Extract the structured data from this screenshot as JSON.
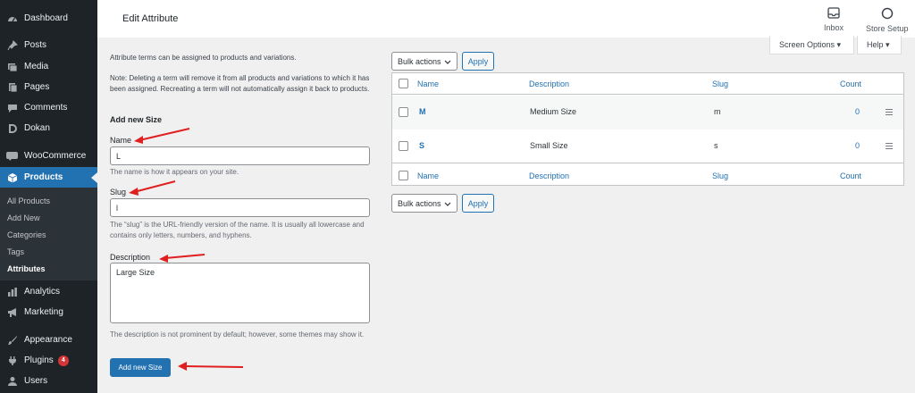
{
  "sidebar": {
    "items": [
      {
        "label": "Dashboard",
        "icon": "dashboard-icon"
      },
      {
        "label": "Posts",
        "icon": "pin-icon"
      },
      {
        "label": "Media",
        "icon": "media-icon"
      },
      {
        "label": "Pages",
        "icon": "pages-icon"
      },
      {
        "label": "Comments",
        "icon": "comment-icon"
      },
      {
        "label": "Dokan",
        "icon": "dokan-icon"
      },
      {
        "label": "WooCommerce",
        "icon": "woo-icon"
      },
      {
        "label": "Products",
        "icon": "box-icon"
      },
      {
        "label": "Analytics",
        "icon": "bar-chart-icon"
      },
      {
        "label": "Marketing",
        "icon": "megaphone-icon"
      },
      {
        "label": "Appearance",
        "icon": "brush-icon"
      },
      {
        "label": "Plugins",
        "icon": "plug-icon",
        "badge": "4"
      },
      {
        "label": "Users",
        "icon": "user-icon"
      }
    ],
    "submenu": [
      "All Products",
      "Add New",
      "Categories",
      "Tags",
      "Attributes"
    ]
  },
  "header": {
    "title": "Edit Attribute",
    "inbox": "Inbox",
    "store_setup": "Store Setup",
    "screen_options": "Screen Options ▾",
    "help": "Help ▾"
  },
  "form": {
    "intro": "Attribute terms can be assigned to products and variations.",
    "note": "Note: Deleting a term will remove it from all products and variations to which it has been assigned. Recreating a term will not automatically assign it back to products.",
    "heading": "Add new Size",
    "name_label": "Name",
    "name_value": "L",
    "name_desc": "The name is how it appears on your site.",
    "slug_label": "Slug",
    "slug_value": "l",
    "slug_desc": "The “slug” is the URL-friendly version of the name. It is usually all lowercase and contains only letters, numbers, and hyphens.",
    "description_label": "Description",
    "description_value": "Large Size",
    "description_desc": "The description is not prominent by default; however, some themes may show it.",
    "submit": "Add new Size"
  },
  "table": {
    "bulk_actions": "Bulk actions",
    "apply": "Apply",
    "columns": [
      "Name",
      "Description",
      "Slug",
      "Count"
    ],
    "rows": [
      {
        "name": "M",
        "description": "Medium Size",
        "slug": "m",
        "count": "0"
      },
      {
        "name": "S",
        "description": "Small Size",
        "slug": "s",
        "count": "0"
      }
    ]
  },
  "colors": {
    "sidebar_bg": "#1d2327",
    "active": "#2271b1",
    "arrow": "#e02020"
  }
}
